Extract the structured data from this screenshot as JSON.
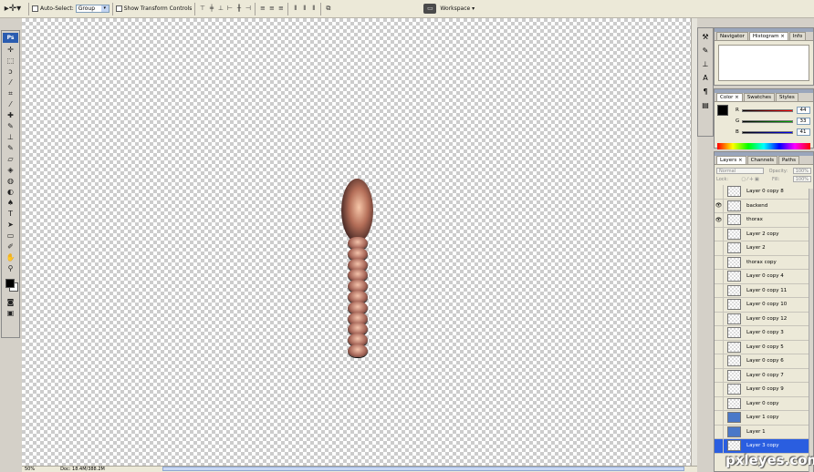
{
  "options_bar": {
    "auto_select_label": "Auto-Select:",
    "auto_select_value": "Group",
    "show_transform_label": "Show Transform Controls",
    "workspace_label": "Workspace ▾"
  },
  "toolbox": {
    "logo": "Ps",
    "tools": [
      "move-tool",
      "marquee-tool",
      "lasso-tool",
      "magic-wand-tool",
      "crop-tool",
      "eyedropper-tool",
      "healing-brush-tool",
      "brush-tool",
      "clone-stamp-tool",
      "history-brush-tool",
      "eraser-tool",
      "gradient-tool",
      "blur-tool",
      "dodge-tool",
      "pen-tool",
      "type-tool",
      "path-selection-tool",
      "shape-tool",
      "notes-tool",
      "hand-tool",
      "zoom-tool"
    ]
  },
  "status_bar": {
    "zoom": "50%",
    "doc": "Doc: 18.4M/388.2M"
  },
  "panels": {
    "navigator": {
      "tabs": [
        "Navigator",
        "Histogram ×",
        "Info"
      ],
      "active": 1
    },
    "color": {
      "tabs": [
        "Color ×",
        "Swatches",
        "Styles"
      ],
      "active": 0,
      "r_label": "R",
      "g_label": "G",
      "b_label": "B",
      "r": "44",
      "g": "33",
      "b": "41"
    },
    "layers": {
      "tabs": [
        "Layers ×",
        "Channels",
        "Paths"
      ],
      "active": 0,
      "blend_mode": "Normal",
      "opacity_label": "Opacity:",
      "opacity": "100%",
      "lock_label": "Lock:",
      "fill_label": "Fill:",
      "fill": "100%",
      "items": [
        {
          "name": "Layer 0 copy 8",
          "visible": false,
          "thumb": "check"
        },
        {
          "name": "backend",
          "visible": true,
          "thumb": "check"
        },
        {
          "name": "thorax",
          "visible": true,
          "thumb": "check"
        },
        {
          "name": "Layer 2 copy",
          "visible": false,
          "thumb": "check"
        },
        {
          "name": "Layer 2",
          "visible": false,
          "thumb": "check"
        },
        {
          "name": "thorax copy",
          "visible": false,
          "thumb": "check"
        },
        {
          "name": "Layer 0 copy 4",
          "visible": false,
          "thumb": "check"
        },
        {
          "name": "Layer 0 copy 11",
          "visible": false,
          "thumb": "check"
        },
        {
          "name": "Layer 0 copy 10",
          "visible": false,
          "thumb": "check"
        },
        {
          "name": "Layer 0 copy 12",
          "visible": false,
          "thumb": "check"
        },
        {
          "name": "Layer 0 copy 3",
          "visible": false,
          "thumb": "check"
        },
        {
          "name": "Layer 0 copy 5",
          "visible": false,
          "thumb": "check"
        },
        {
          "name": "Layer 0 copy 6",
          "visible": false,
          "thumb": "check"
        },
        {
          "name": "Layer 0 copy 7",
          "visible": false,
          "thumb": "check"
        },
        {
          "name": "Layer 0 copy 9",
          "visible": false,
          "thumb": "check"
        },
        {
          "name": "Layer 0 copy",
          "visible": false,
          "thumb": "check"
        },
        {
          "name": "Layer 1 copy",
          "visible": false,
          "thumb": "blue"
        },
        {
          "name": "Layer 1",
          "visible": false,
          "thumb": "blue"
        },
        {
          "name": "Layer 3 copy",
          "visible": false,
          "thumb": "check",
          "selected": true
        }
      ]
    }
  },
  "watermark": "pxleyes.com"
}
